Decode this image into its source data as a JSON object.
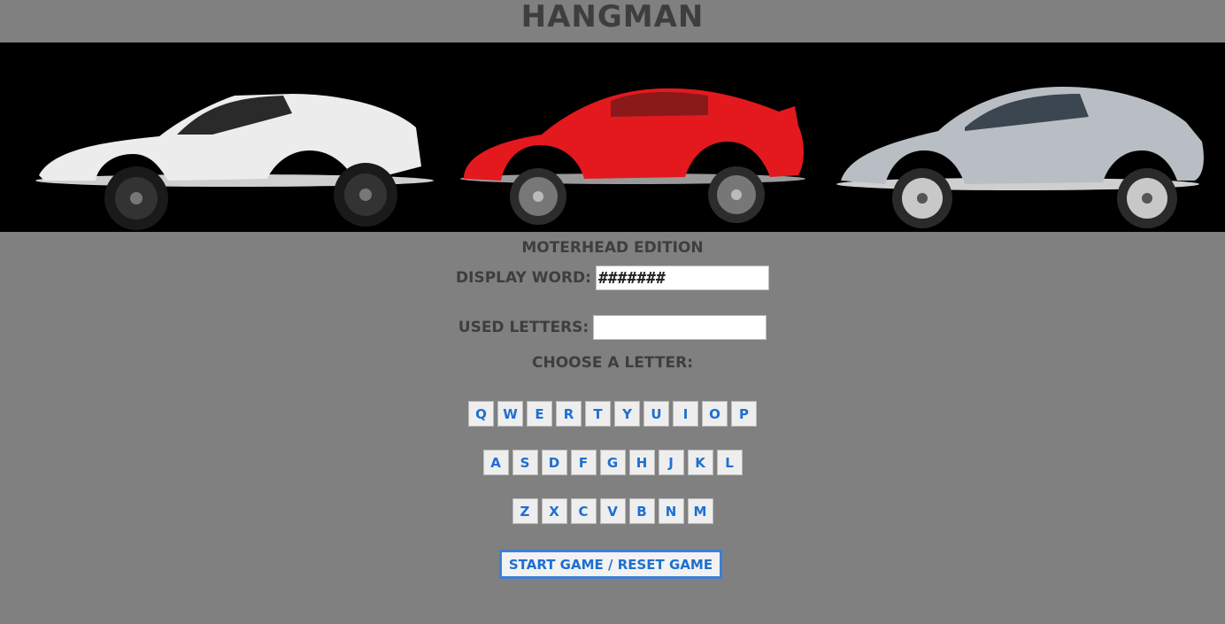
{
  "header": {
    "title": "HANGMAN"
  },
  "banner": {
    "cars": [
      {
        "icon": "white-spyder-car-icon",
        "color": "#ececec"
      },
      {
        "icon": "red-coupe-car-icon",
        "color": "#e3191e"
      },
      {
        "icon": "silver-coupe-car-icon",
        "color": "#b9bec4"
      }
    ]
  },
  "subtitle": "MOTERHEAD EDITION",
  "display_word": {
    "label": "DISPLAY WORD:",
    "value": "#######"
  },
  "used_letters": {
    "label": "USED LETTERS:",
    "value": ""
  },
  "choose_label": "CHOOSE A LETTER:",
  "keyboard": {
    "row1": [
      "Q",
      "W",
      "E",
      "R",
      "T",
      "Y",
      "U",
      "I",
      "O",
      "P"
    ],
    "row2": [
      "A",
      "S",
      "D",
      "F",
      "G",
      "H",
      "J",
      "K",
      "L"
    ],
    "row3": [
      "Z",
      "X",
      "C",
      "V",
      "B",
      "N",
      "M"
    ]
  },
  "start_button": "START GAME / RESET GAME",
  "colors": {
    "background": "#808080",
    "key_text": "#1e6fd0",
    "accent_border": "#3c7fd6"
  }
}
